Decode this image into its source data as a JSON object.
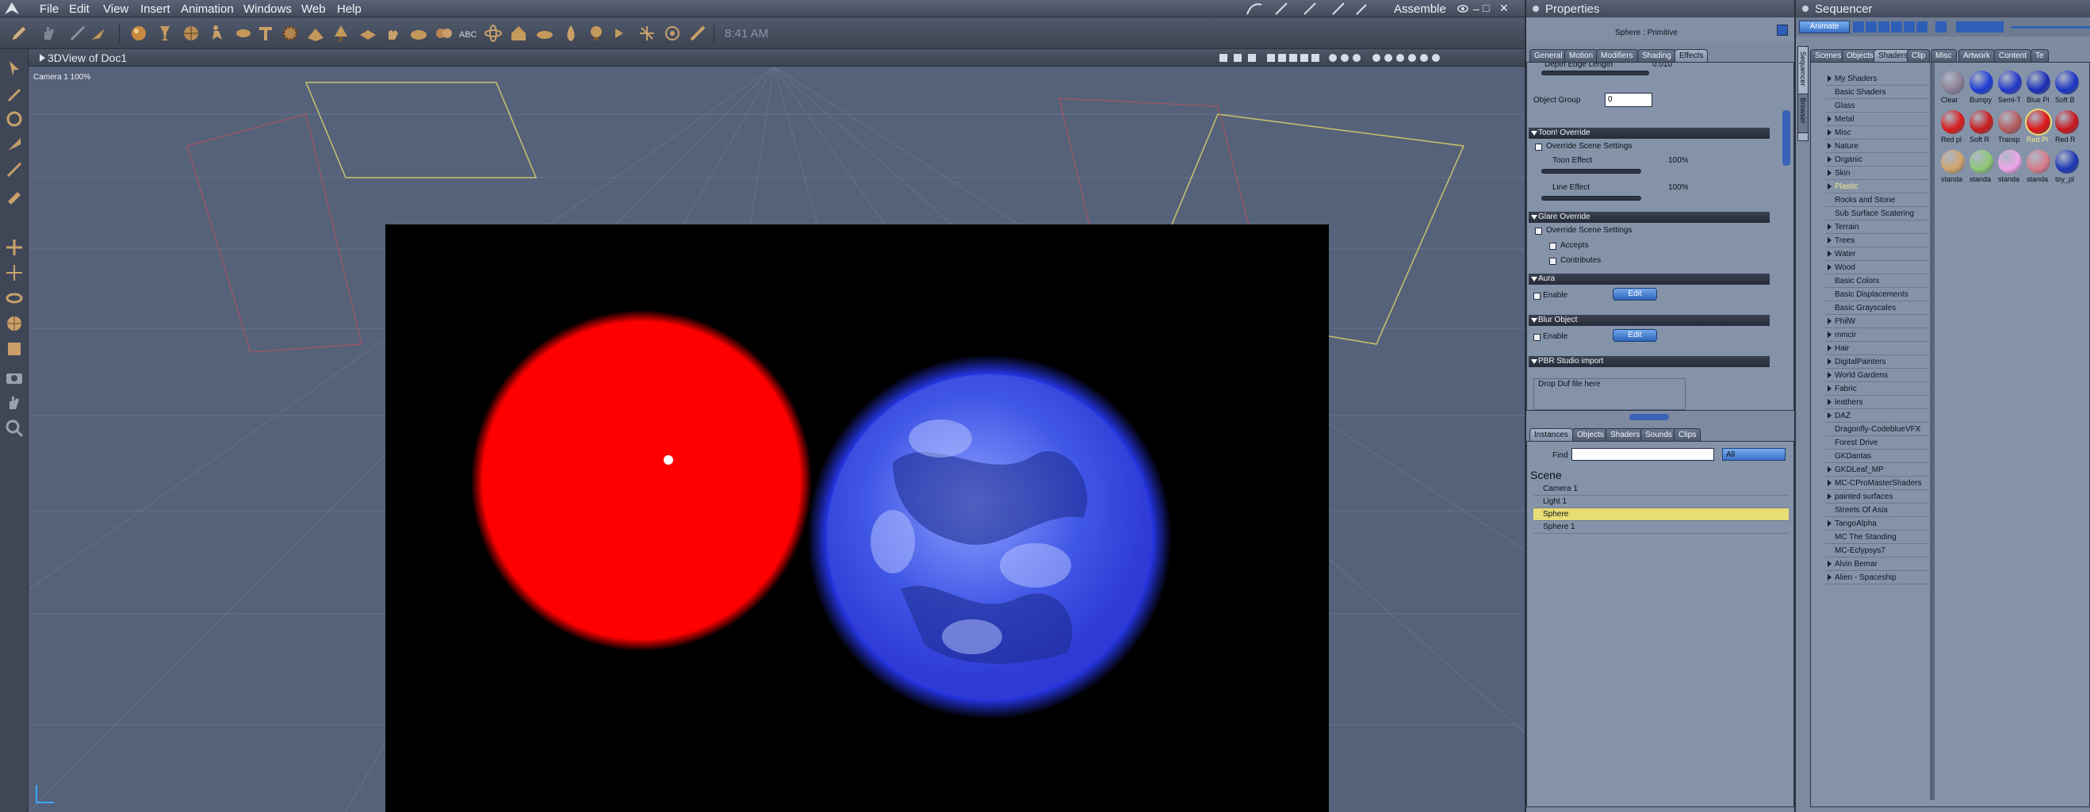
{
  "menubar": {
    "items": [
      "File",
      "Edit",
      "View",
      "Insert",
      "Animation",
      "Windows",
      "Web",
      "Help"
    ],
    "mode": "Assemble"
  },
  "toolbar": {
    "time": "8:41 AM"
  },
  "viewport": {
    "title": "3DView of Doc1",
    "camera_label": "Camera 1  100%"
  },
  "properties": {
    "panel_title": "Properties",
    "object_name": "Sphere : Primitive",
    "tabs": [
      "General",
      "Motion",
      "Modifiers",
      "Shading",
      "Effects"
    ],
    "active_tab": "Effects",
    "depth_edge_label": "Depth Edge Length",
    "depth_edge_value": "0.010",
    "object_group_label": "Object Group",
    "object_group_value": "0",
    "toon_header": "Toon! Override",
    "toon_override": "Override Scene Settings",
    "toon_effect_label": "Toon Effect",
    "toon_effect_value": "100%",
    "line_effect_label": "Line Effect",
    "line_effect_value": "100%",
    "glare_header": "Glare Override",
    "glare_override": "Override Scene Settings",
    "accepts": "Accepts",
    "contributes": "Contributes",
    "aura_header": "Aura",
    "aura_enable": "Enable",
    "edit_label": "Edit",
    "blur_header": "Blur Object",
    "blur_enable": "Enable",
    "pbr_header": "PBR Studio import",
    "pbr_drop": "Drop Duf file here"
  },
  "browser": {
    "tabs": [
      "Instances",
      "Objects",
      "Shaders",
      "Sounds",
      "Clips"
    ],
    "active_tab": "Instances",
    "find_label": "Find",
    "filter": "All",
    "scene_label": "Scene",
    "items": [
      "Camera 1",
      "Light 1",
      "Sphere",
      "Sphere 1"
    ],
    "selected": "Sphere"
  },
  "sequencer": {
    "panel_title": "Sequencer",
    "animate_label": "Animate",
    "side_tabs": [
      "Sequencer",
      "Browser"
    ],
    "tabs": [
      "Scenes",
      "Objects",
      "Shaders",
      "Clip",
      "Misc",
      "Artwork",
      "Content",
      "Te"
    ],
    "active_tab": "Shaders",
    "categories": [
      {
        "label": "My Shaders",
        "expand": true
      },
      {
        "label": "Basic Shaders",
        "expand": false
      },
      {
        "label": "Glass",
        "expand": false
      },
      {
        "label": "Metal",
        "expand": true
      },
      {
        "label": "Misc",
        "expand": true
      },
      {
        "label": "Nature",
        "expand": true
      },
      {
        "label": "Organic",
        "expand": true
      },
      {
        "label": "Skin",
        "expand": true
      },
      {
        "label": "Plastic",
        "expand": true,
        "selected": true
      },
      {
        "label": "Rocks and Stone",
        "expand": false
      },
      {
        "label": "Sub Surface Scatering",
        "expand": false
      },
      {
        "label": "Terrain",
        "expand": true
      },
      {
        "label": "Trees",
        "expand": true
      },
      {
        "label": "Water",
        "expand": true
      },
      {
        "label": "Wood",
        "expand": true
      },
      {
        "label": "Basic Colors",
        "expand": false
      },
      {
        "label": "Basic Displacements",
        "expand": false
      },
      {
        "label": "Basic Grayscales",
        "expand": false
      },
      {
        "label": "PhilW",
        "expand": true
      },
      {
        "label": "mmcir",
        "expand": true
      },
      {
        "label": "Hair",
        "expand": true
      },
      {
        "label": "DigitalPainters",
        "expand": true
      },
      {
        "label": "World Gardens",
        "expand": true
      },
      {
        "label": "Fabric",
        "expand": true
      },
      {
        "label": "leathers",
        "expand": true
      },
      {
        "label": "DAZ",
        "expand": true
      },
      {
        "label": "Dragonfly-CodeblueVFX",
        "expand": false
      },
      {
        "label": "Forest Drive",
        "expand": false
      },
      {
        "label": "GKDantas",
        "expand": false
      },
      {
        "label": "GKDLeaf_MP",
        "expand": true
      },
      {
        "label": "MC-CProMasterShaders",
        "expand": true
      },
      {
        "label": "painted surfaces",
        "expand": true
      },
      {
        "label": "Streets Of Asia",
        "expand": false
      },
      {
        "label": "TangoAlpha",
        "expand": true
      },
      {
        "label": "MC The Standing",
        "expand": false
      },
      {
        "label": "MC-Eclypsys7",
        "expand": false
      },
      {
        "label": "Alvin Bemar",
        "expand": true
      },
      {
        "label": "Alien - Spaceship",
        "expand": true
      }
    ],
    "swatches": [
      {
        "label": "Clear",
        "color": "#8b7f96"
      },
      {
        "label": "Bumpy",
        "color": "#1d3bd6"
      },
      {
        "label": "Semi-T",
        "color": "#2236c9"
      },
      {
        "label": "Blue Pl",
        "color": "#1a2fb8"
      },
      {
        "label": "Soft B",
        "color": "#1c33c4"
      },
      {
        "label": "Red pl",
        "color": "#d81a1a"
      },
      {
        "label": "Soft R",
        "color": "#c91b1b"
      },
      {
        "label": "Transp",
        "color": "#b65a5a"
      },
      {
        "label": "Red Pl",
        "color": "#e01414",
        "selected": true
      },
      {
        "label": "Red R",
        "color": "#c8151c"
      },
      {
        "label": "standa",
        "color": "#d2a36c"
      },
      {
        "label": "standa",
        "color": "#8ec874"
      },
      {
        "label": "standa",
        "color": "#f0a5ea"
      },
      {
        "label": "standa",
        "color": "#d87c88"
      },
      {
        "label": "toy_pl",
        "color": "#1c36b5"
      }
    ]
  }
}
